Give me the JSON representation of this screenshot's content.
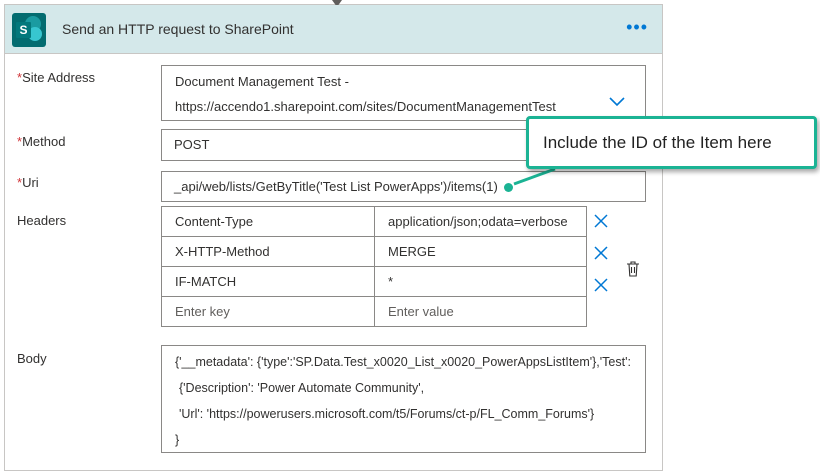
{
  "action": {
    "title": "Send an HTTP request to SharePoint",
    "more_label": "•••",
    "logo_letter": "S"
  },
  "labels": {
    "required_mark": "*",
    "site_address": "Site Address",
    "method": "Method",
    "uri": "Uri",
    "headers": "Headers",
    "body": "Body"
  },
  "site_address": {
    "line1": "Document Management Test -",
    "line2": "https://accendo1.sharepoint.com/sites/DocumentManagementTest"
  },
  "method": {
    "value": "POST"
  },
  "uri": {
    "value": "_api/web/lists/GetByTitle('Test List PowerApps')/items(1)"
  },
  "headers": {
    "rows": [
      {
        "key": "Content-Type",
        "value": "application/json;odata=verbose"
      },
      {
        "key": "X-HTTP-Method",
        "value": "MERGE"
      },
      {
        "key": "IF-MATCH",
        "value": "*"
      }
    ],
    "key_placeholder": "Enter key",
    "value_placeholder": "Enter value"
  },
  "body": {
    "lines": [
      "{'__metadata': {'type':'SP.Data.Test_x0020_List_x0020_PowerAppsListItem'},'Test':",
      "{'Description': 'Power Automate Community',",
      "'Url': 'https://powerusers.microsoft.com/t5/Forums/ct-p/FL_Comm_Forums'}",
      "}"
    ]
  },
  "callout": {
    "text": "Include the ID of the Item here"
  },
  "colors": {
    "header_bg": "#d4e8ea",
    "accent": "#0078d4",
    "required": "#d13438",
    "callout_border": "#1bb394"
  },
  "icons": {
    "logo": "sharepoint-logo-icon",
    "more": "more-options-icon",
    "chevron": "chevron-down-icon",
    "remove": "close-icon",
    "delete": "trash-icon"
  }
}
